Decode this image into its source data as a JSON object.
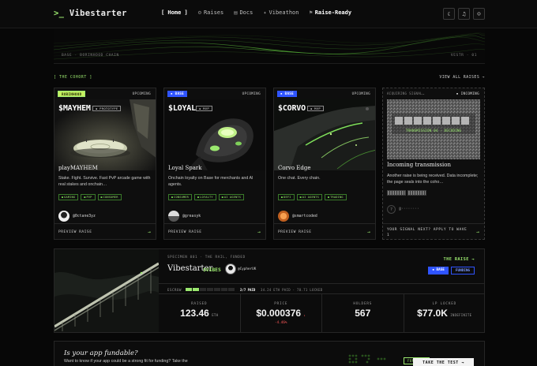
{
  "nav": {
    "logo_prompt": ">_",
    "logo_text": "Vibestarter",
    "links": [
      {
        "label": "[ Home ]",
        "icon": ""
      },
      {
        "label": "Raises",
        "icon": "rocket-icon"
      },
      {
        "label": "Docs",
        "icon": "docs-icon"
      },
      {
        "label": "Vibeathon",
        "icon": "sparkle-icon"
      },
      {
        "label": "Raise-Ready",
        "icon": "flag-icon"
      }
    ],
    "icons": [
      "moon-icon",
      "bell-icon",
      "user-icon"
    ]
  },
  "hero": {
    "left_caption": "BASE · BORINHOOD CHAIN",
    "right_caption": "VESTR · 01"
  },
  "cohort": {
    "label": "[ THE COHORT ]",
    "view_all": "VIEW ALL RAISES →"
  },
  "cards": [
    {
      "badge": "ROBINHOOD",
      "badge_style": "green",
      "status": "UPCOMING",
      "ticker": "$MAYHEM",
      "stage": "▪ PROTOTYPE",
      "name": "playMAYHEM",
      "desc": "Stake. Fight. Survive. Fast PvP arcade game with real stakes and onchain…",
      "tags": [
        "GAMING",
        "PVP",
        "CONSUMER"
      ],
      "author": "@0ctane3yz",
      "cta": "PREVIEW RAISE",
      "arrow": "→"
    },
    {
      "badge": "▪ BASE",
      "badge_style": "blue",
      "status": "UPCOMING",
      "ticker": "$LOYAL",
      "stage": "▪ MVP",
      "name": "Loyal Spark",
      "desc": "Onchain loyalty on Base for merchants and AI agents.",
      "tags": [
        "CONSUMER",
        "LOYALTY",
        "AI AGENTS"
      ],
      "author": "@greasyk",
      "cta": "PREVIEW RAISE",
      "arrow": "→"
    },
    {
      "badge": "▪ BASE",
      "badge_style": "blue",
      "status": "UPCOMING",
      "ticker": "$CORVO",
      "stage": "▪ MVP",
      "name": "Corvo Edge",
      "desc": "One chat. Every chain.",
      "tags": [
        "DEFI",
        "AI AGENTS",
        "TRADING"
      ],
      "author": "@smartcoded",
      "cta": "PREVIEW RAISE",
      "arrow": "→"
    }
  ],
  "incoming": {
    "top_left": "ACQUIRING SIGNAL…",
    "top_right": "▪ INCOMING",
    "transmission_text": "TRANSMISSION 04 · DECODING",
    "title": "Incoming transmission",
    "desc": "Another raise is being received. Data incomplete; the page seals into the coho…",
    "handle": "@········",
    "cta": "YOUR SIGNAL NEXT? APPLY TO WAVE 1",
    "arrow": "→"
  },
  "specimen": {
    "label": "SPECIMEN 001 · THE RAIL, FUNDED",
    "title": "Vibestarter",
    "ticker": "$VIBES",
    "creator": "@CypherUK",
    "raise_link": "THE RAISE →",
    "badges": [
      "▪ BASE",
      "FUNDING"
    ],
    "escrow_label": "ESCROW",
    "escrow_paid": 2,
    "escrow_total": 7,
    "escrow_paid_text": "2/7 PAID",
    "escrow_info": "34.24 ETH PAID · 78.71 LOCKED",
    "stats": [
      {
        "label": "RAISED",
        "value": "123.46",
        "unit": "ETH",
        "delta": ""
      },
      {
        "label": "PRICE",
        "value": "$0.000376",
        "unit": "↓",
        "delta": "-4.46%"
      },
      {
        "label": "HOLDERS",
        "value": "567",
        "unit": "",
        "delta": ""
      },
      {
        "label": "LP LOCKED",
        "value": "$77.0K",
        "unit": "INDEFINITE",
        "delta": ""
      }
    ]
  },
  "bottom": {
    "question_pre": "Is your app ",
    "question_em": "fundable",
    "question_post": "?",
    "desc": "Want to know if your app could be a strong fit for funding? Take the",
    "fund_badge": "FUNDABLE",
    "cta": "TAKE THE TEST →"
  },
  "colors": {
    "accent_green": "#9be86f",
    "base_blue": "#2f54ff",
    "negative_red": "#ff5a5a",
    "bg": "#070707"
  }
}
